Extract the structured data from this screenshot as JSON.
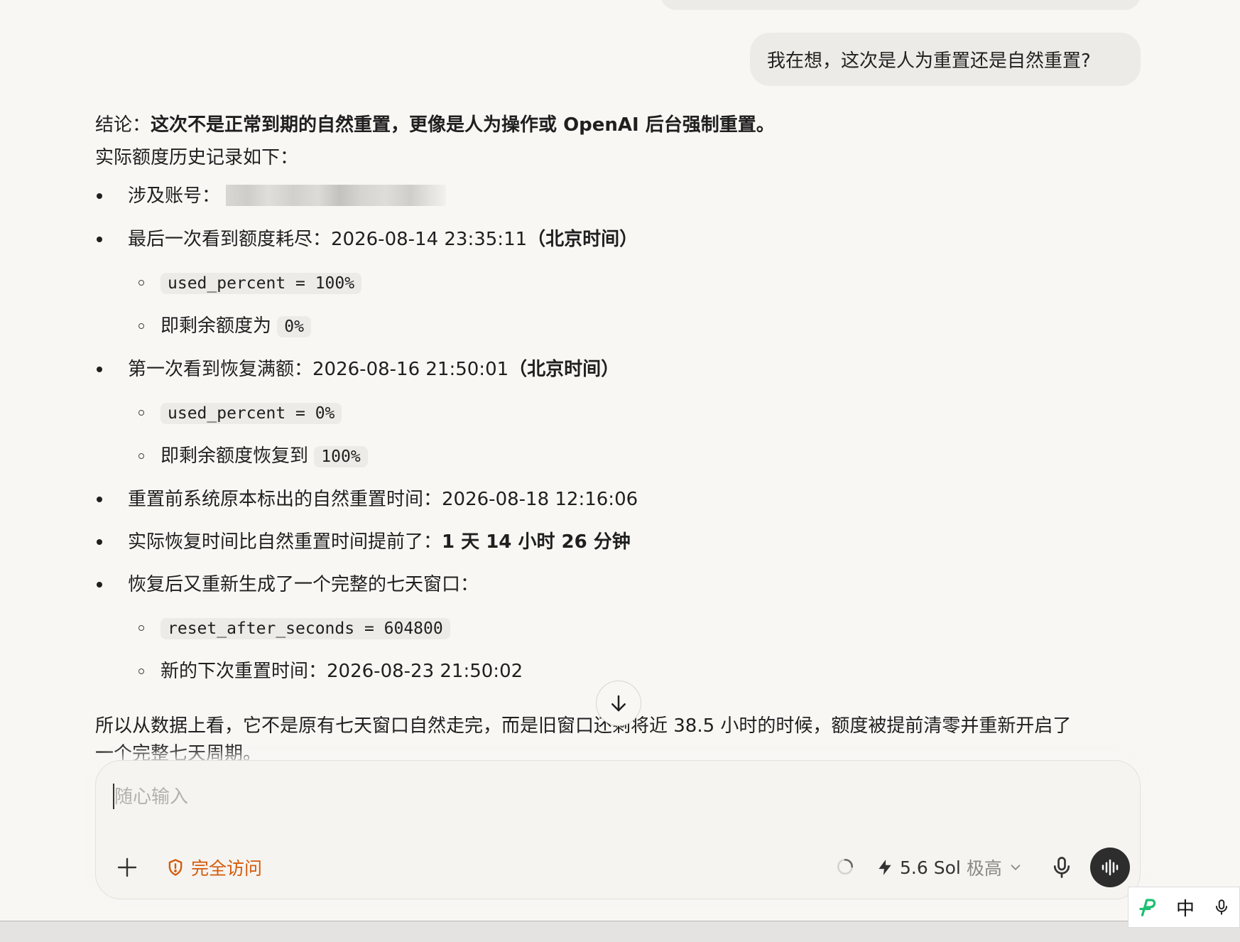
{
  "user_message": "我在想，这次是人为重置还是自然重置?",
  "reply": {
    "conclusion_label": "结论：",
    "conclusion_bold": "这次不是正常到期的自然重置，更像是人为操作或 OpenAI 后台强制重置。",
    "history_intro": "实际额度历史记录如下：",
    "account_label": "涉及账号：",
    "last_exhausted_label": "最后一次看到额度耗尽：",
    "last_exhausted_value": "2026-08-14 23:35:11",
    "last_exhausted_tz": "（北京时间）",
    "used_percent_full": "used_percent = 100%",
    "remaining_label": "即剩余额度为",
    "remaining_value": "0%",
    "first_full_label": "第一次看到恢复满额：",
    "first_full_value": "2026-08-16 21:50:01",
    "first_full_tz": "（北京时间）",
    "used_percent_zero": "used_percent = 0%",
    "restored_label": "即剩余额度恢复到",
    "restored_value": "100%",
    "natural_reset_label": "重置前系统原本标出的自然重置时间：",
    "natural_reset_value": "2026-08-18 12:16:06",
    "advance_label": "实际恢复时间比自然重置时间提前了：",
    "advance_value": "1 天 14 小时 26 分钟",
    "new_window_label": "恢复后又重新生成了一个完整的七天窗口：",
    "reset_seconds": "reset_after_seconds = 604800",
    "next_reset_label": "新的下次重置时间：",
    "next_reset_value": "2026-08-23 21:50:02",
    "summary": "所以从数据上看，它不是原有七天窗口自然走完，而是旧窗口还剩将近 38.5 小时的时候，额度被提前清零并重新开启了",
    "summary_cont": "一个完整七天周期。"
  },
  "composer": {
    "placeholder": "随心输入",
    "access_label": "完全访问",
    "model_label": "5.6 Sol",
    "effort_label": "极高"
  },
  "ime": {
    "mode": "中"
  },
  "colors": {
    "accent_orange": "#d45a0b",
    "ime_green": "#1dbf73"
  },
  "icons": [
    "arrow-down-icon",
    "plus-icon",
    "shield-alert-icon",
    "spinner-icon",
    "lightning-icon",
    "chevron-down-icon",
    "microphone-icon",
    "voice-wave-icon",
    "ime-logo-icon",
    "ime-mic-icon"
  ]
}
